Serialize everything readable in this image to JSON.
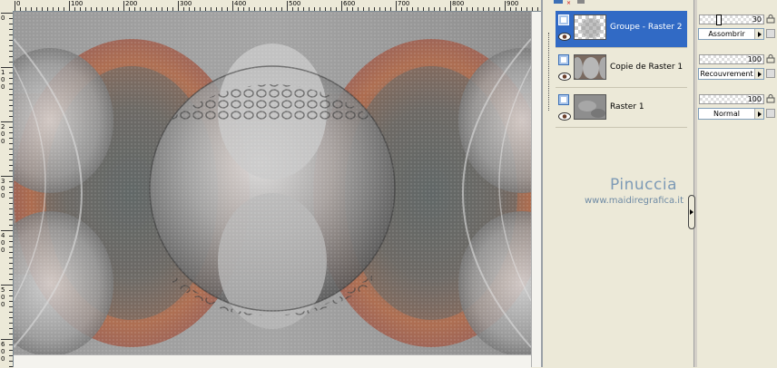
{
  "ruler": {
    "top_labels": [
      "0",
      "100",
      "200",
      "300",
      "400",
      "500",
      "600",
      "700",
      "800",
      "900"
    ],
    "left_labels": [
      "0",
      "100",
      "200",
      "300",
      "400",
      "500",
      "600"
    ]
  },
  "layers": [
    {
      "name": "Groupe - Raster 2",
      "selected": true,
      "opacity": "30",
      "blend": "Assombrir"
    },
    {
      "name": "Copie de Raster 1",
      "selected": false,
      "opacity": "100",
      "blend": "Recouvrement"
    },
    {
      "name": "Raster 1",
      "selected": false,
      "opacity": "100",
      "blend": "Normal"
    }
  ],
  "watermark": {
    "title": "Pinuccia",
    "url": "www.maidiregrafica.it"
  },
  "colors": {
    "selection": "#316ac5",
    "panel_bg": "#ece9d8",
    "accent_copper": "#b06a4a"
  },
  "icons": {
    "layer_type": "raster-layer-icon",
    "visibility": "eye-icon",
    "lock": "lock-icon",
    "mask": "mask-icon"
  }
}
